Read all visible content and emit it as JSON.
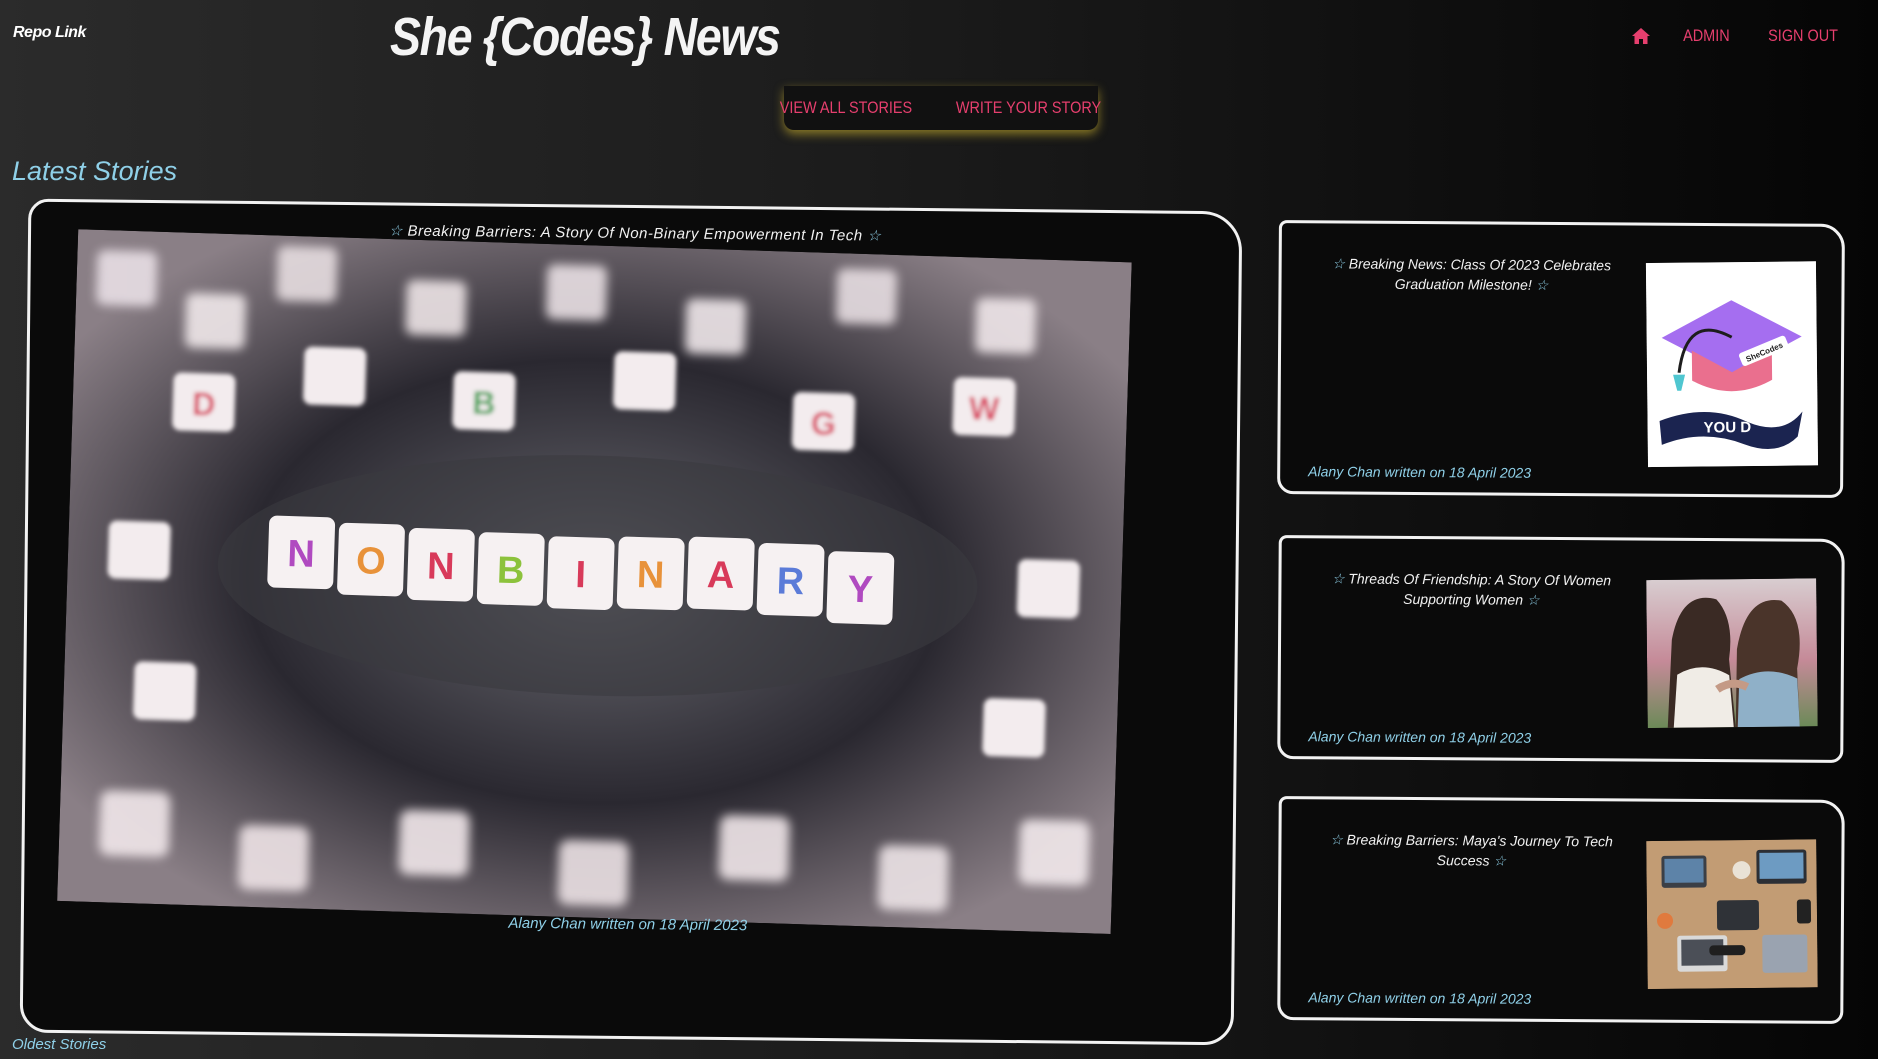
{
  "header": {
    "repo_link": "Repo Link",
    "site_title": "She {Codes} News",
    "nav": {
      "home_icon": "home-icon",
      "admin": "ADMIN",
      "sign_out": "SIGN OUT"
    }
  },
  "sub_nav": {
    "view_all": "VIEW ALL STORIES",
    "write": "WRITE YOUR STORY"
  },
  "section": {
    "heading": "Latest Stories",
    "oldest": "Oldest Stories"
  },
  "featured": {
    "title": "Breaking Barriers: A Story Of Non-Binary Empowerment In Tech",
    "byline": "Alany Chan written on 18 April 2023",
    "image_text": "NONBINARY"
  },
  "stories": [
    {
      "title": "Breaking News: Class Of 2023 Celebrates Graduation Milestone!",
      "byline": "Alany Chan written on 18 April 2023",
      "image_label": "SheCodes",
      "image_banner": "YOU D"
    },
    {
      "title": "Threads Of Friendship: A Story Of Women Supporting Women",
      "byline": "Alany Chan written on 18 April 2023"
    },
    {
      "title": "Breaking Barriers: Maya's Journey To Tech Success",
      "byline": "Alany Chan written on 18 April 2023"
    }
  ],
  "colors": {
    "accent": "#e63f6e",
    "link_blue": "#8fd0e8",
    "glow": "#e6c832"
  }
}
